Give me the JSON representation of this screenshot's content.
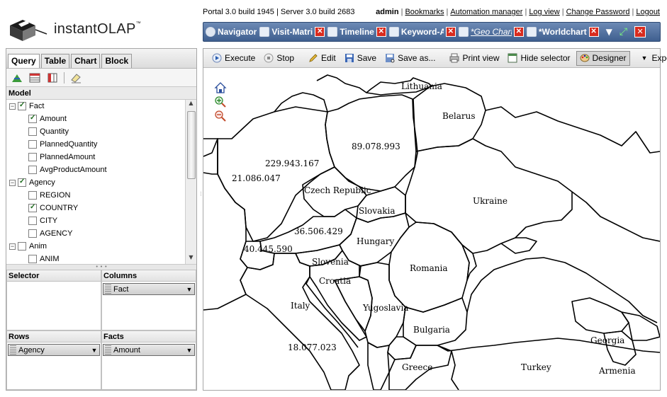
{
  "app": {
    "logo_text": "instantOLAP",
    "logo_tm": "™",
    "build_info": "Portal 3.0 build 1945 | Server 3.0 build 2683",
    "user": "admin",
    "links": [
      "Bookmarks",
      "Automation manager",
      "Log view",
      "Change Password",
      "Logout"
    ]
  },
  "tabs": [
    {
      "label": "Navigator",
      "icon": "compass-icon",
      "closable": false,
      "active": false
    },
    {
      "label": "Visit-Matri",
      "icon": "table-icon",
      "closable": true,
      "active": false
    },
    {
      "label": "Timeline",
      "icon": "table-icon",
      "closable": true,
      "active": false
    },
    {
      "label": "Keyword-A",
      "icon": "table-icon",
      "closable": true,
      "active": false
    },
    {
      "label": "*Geo Chart",
      "icon": "table-icon",
      "closable": true,
      "active": true
    },
    {
      "label": "*Worldchart",
      "icon": "table-icon",
      "closable": true,
      "active": false
    }
  ],
  "left": {
    "tabs": [
      "Query",
      "Table",
      "Chart",
      "Block"
    ],
    "active_tab": "Query",
    "model_title": "Model",
    "tree": [
      {
        "label": "Fact",
        "level": 0,
        "expander": "−",
        "checked": true
      },
      {
        "label": "Amount",
        "level": 1,
        "checked": true
      },
      {
        "label": "Quantity",
        "level": 1,
        "checked": false
      },
      {
        "label": "PlannedQuantity",
        "level": 1,
        "checked": false
      },
      {
        "label": "PlannedAmount",
        "level": 1,
        "checked": false
      },
      {
        "label": "AvgProductAmount",
        "level": 1,
        "checked": false
      },
      {
        "label": "Agency",
        "level": 0,
        "expander": "−",
        "checked": true
      },
      {
        "label": "REGION",
        "level": 1,
        "checked": false
      },
      {
        "label": "COUNTRY",
        "level": 1,
        "checked": true
      },
      {
        "label": "CITY",
        "level": 1,
        "checked": false
      },
      {
        "label": "AGENCY",
        "level": 1,
        "checked": false
      },
      {
        "label": "Anim",
        "level": 0,
        "expander": "−",
        "checked": false
      },
      {
        "label": "ANIM",
        "level": 1,
        "checked": false
      }
    ],
    "zones": {
      "selector": {
        "title": "Selector",
        "chips": []
      },
      "columns": {
        "title": "Columns",
        "chips": [
          "Fact"
        ]
      },
      "rows": {
        "title": "Rows",
        "chips": [
          "Agency"
        ]
      },
      "facts": {
        "title": "Facts",
        "chips": [
          "Amount"
        ]
      }
    }
  },
  "toolbar": {
    "execute": "Execute",
    "stop": "Stop",
    "edit": "Edit",
    "save": "Save",
    "save_as": "Save as...",
    "print_view": "Print view",
    "hide_selector": "Hide selector",
    "designer": "Designer",
    "export": "Export"
  },
  "map": {
    "countries": [
      "Lithuania",
      "Belarus",
      "Czech Republic",
      "Slovakia",
      "Ukraine",
      "Hungary",
      "Romania",
      "Slovenia",
      "Croatia",
      "Italy",
      "Yugoslavia",
      "Bulgaria",
      "Georgia",
      "Turkey",
      "Armenia",
      "Greece"
    ],
    "values": [
      "229.943.167",
      "21.086.047",
      "89.078.993",
      "36.506.429",
      "40.445.590",
      "18.077.023"
    ],
    "tools": [
      "home-icon",
      "zoom-in-icon",
      "zoom-out-icon"
    ]
  }
}
